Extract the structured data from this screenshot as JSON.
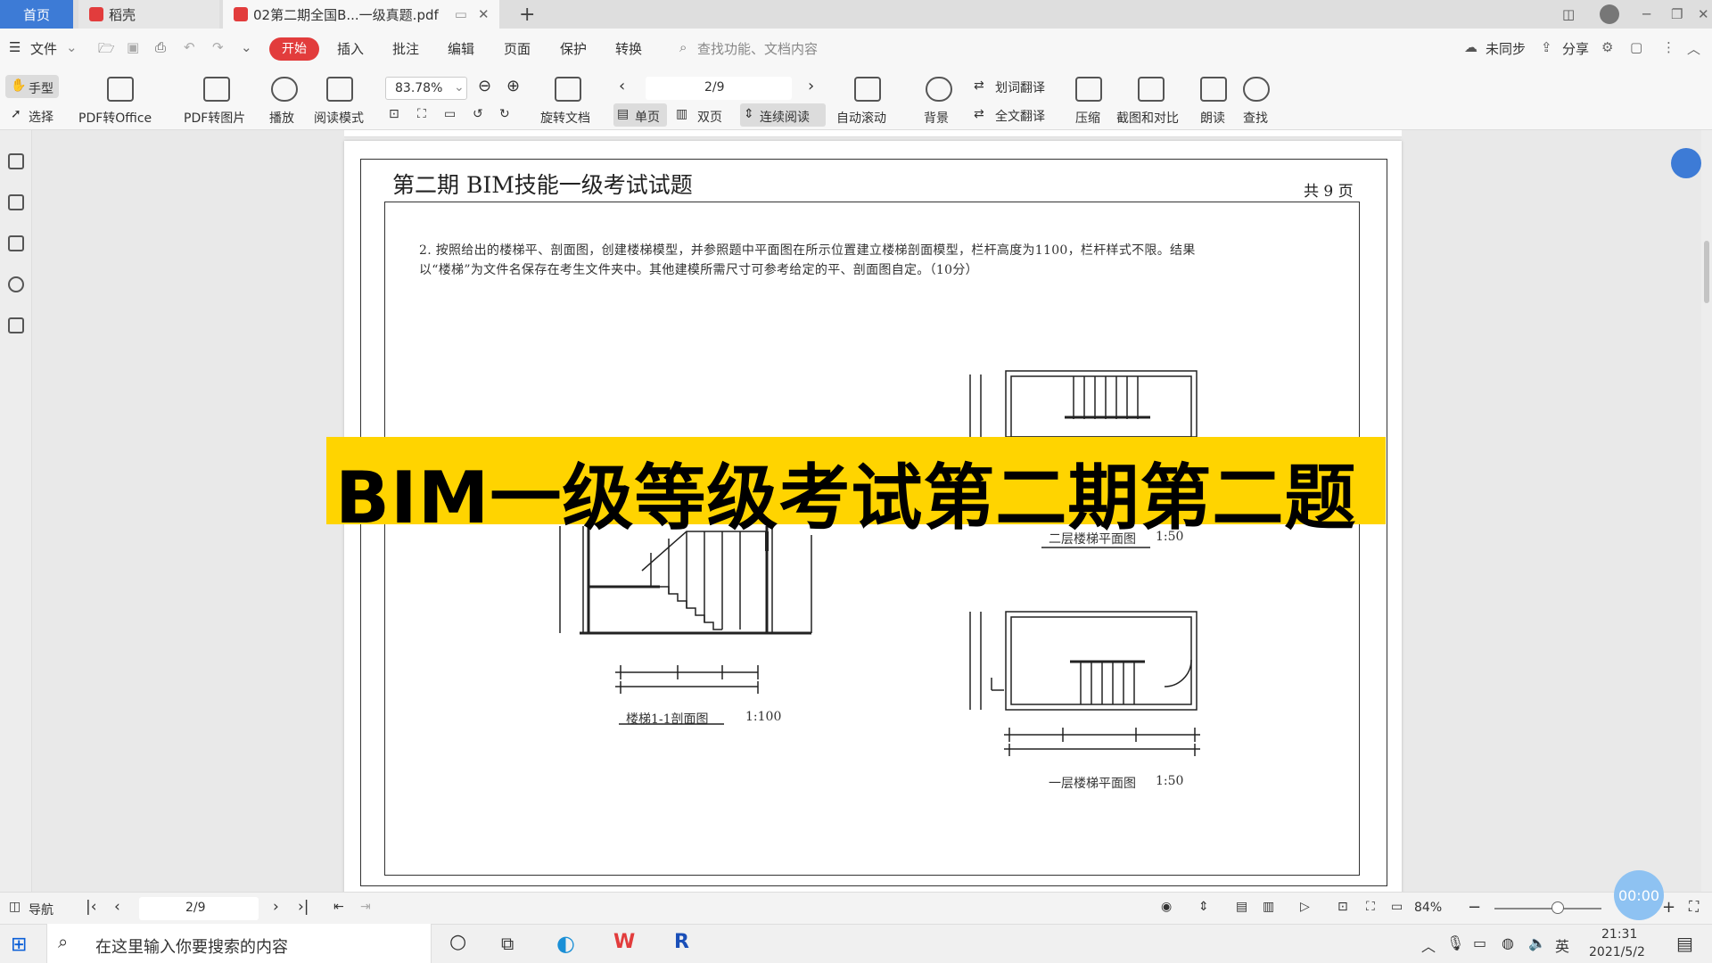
{
  "tabs": {
    "home": "首页",
    "daoke": "稻壳",
    "pdf": "02第二期全国B...一级真题.pdf",
    "new_tab": "+"
  },
  "menu": {
    "file": "文件",
    "start": "开始",
    "insert": "插入",
    "annotate": "批注",
    "edit": "编辑",
    "page": "页面",
    "protect": "保护",
    "convert": "转换",
    "search_placeholder": "查找功能、文档内容",
    "unsynced": "未同步",
    "share": "分享"
  },
  "toolbar": {
    "hand": "手型",
    "select": "选择",
    "pdf_to_office": "PDF转Office",
    "pdf_to_image": "PDF转图片",
    "play": "播放",
    "read_mode": "阅读模式",
    "zoom": "83.78%",
    "page_indicator": "2/9",
    "rotate": "旋转文档",
    "single_page": "单页",
    "double_page": "双页",
    "continuous": "连续阅读",
    "auto_scroll": "自动滚动",
    "background": "背景",
    "word_translate": "划词翻译",
    "full_translate": "全文翻译",
    "compress": "压缩",
    "screenshot_compare": "截图和对比",
    "read_aloud": "朗读",
    "find": "查找"
  },
  "document": {
    "title": "第二期 BIM技能一级考试试题",
    "pages": "共 9 页",
    "question_line1": "2. 按照给出的楼梯平、剖面图，创建楼梯模型，并参照题中平面图在所示位置建立楼梯剖面模型，栏杆高度为1100，栏杆样式不限。结果",
    "question_line2": "以“楼梯”为文件名保存在考生文件夹中。其他建模所需尺寸可参考给定的平、剖面图自定。（10分）",
    "section_label": "楼梯1-1剖面图",
    "section_scale": "1:100",
    "plan2_label": "二层楼梯平面图",
    "plan2_scale": "1:50",
    "plan1_label": "一层楼梯平面图",
    "plan1_scale": "1:50"
  },
  "banner": {
    "text": "BIM一级等级考试第二期第二题"
  },
  "statusbar": {
    "nav": "导航",
    "page_indicator": "2/9",
    "zoom": "84%",
    "timer": "00:00"
  },
  "taskbar": {
    "search_placeholder": "在这里输入你要搜索的内容",
    "ime": "英",
    "time": "21:31",
    "date": "2021/5/2"
  },
  "colors": {
    "accent": "#3d7bd6",
    "start_red": "#e23c3c",
    "banner_yellow": "#ffd400"
  }
}
